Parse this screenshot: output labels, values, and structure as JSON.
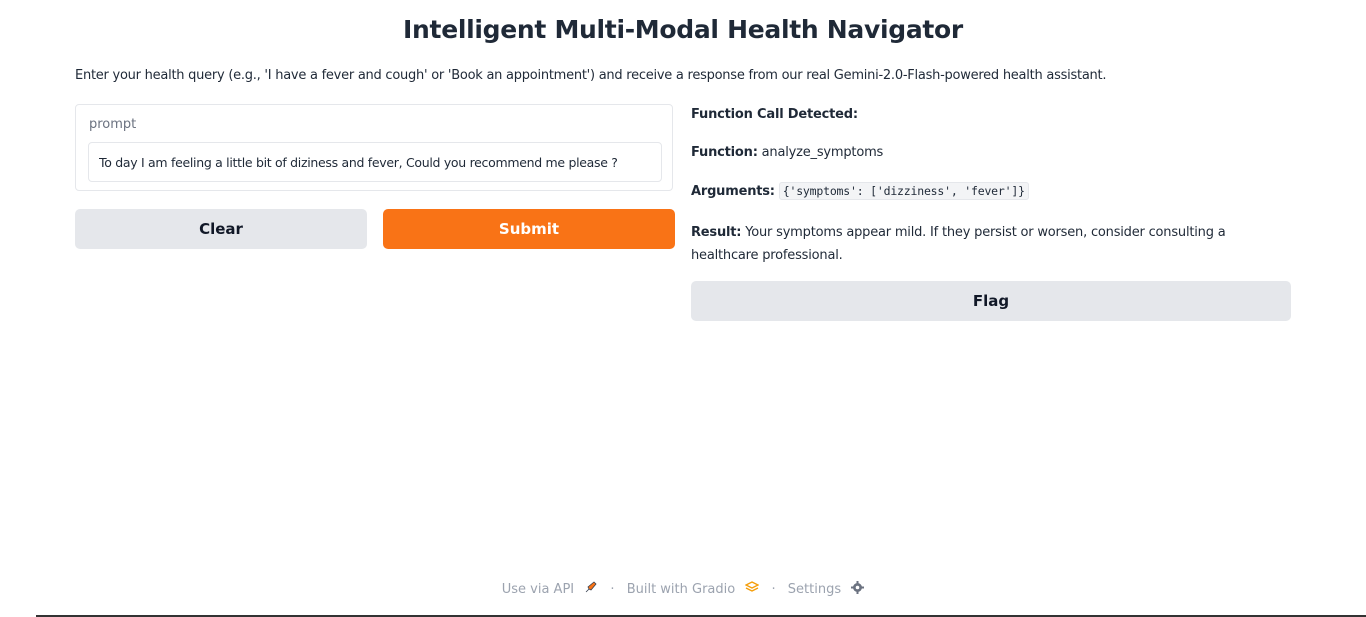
{
  "header": {
    "title": "Intelligent Multi-Modal Health Navigator",
    "description": "Enter your health query (e.g., 'I have a fever and cough' or 'Book an appointment') and receive a response from our real Gemini-2.0-Flash-powered health assistant."
  },
  "input": {
    "label": "prompt",
    "value": "To day I am feeling a little bit of diziness and fever, Could you recommend me please ?"
  },
  "buttons": {
    "clear": "Clear",
    "submit": "Submit",
    "flag": "Flag"
  },
  "output": {
    "heading": "Function Call Detected:",
    "function_label": "Function:",
    "function_value": "analyze_symptoms",
    "arguments_label": "Arguments:",
    "arguments_value": "{'symptoms': ['dizziness', 'fever']}",
    "result_label": "Result:",
    "result_value": "Your symptoms appear mild. If they persist or worsen, consider consulting a healthcare professional."
  },
  "footer": {
    "api": "Use via API",
    "built": "Built with Gradio",
    "settings": "Settings",
    "separator": "·"
  },
  "colors": {
    "accent": "#f97316",
    "secondary_button": "#e5e7eb"
  }
}
